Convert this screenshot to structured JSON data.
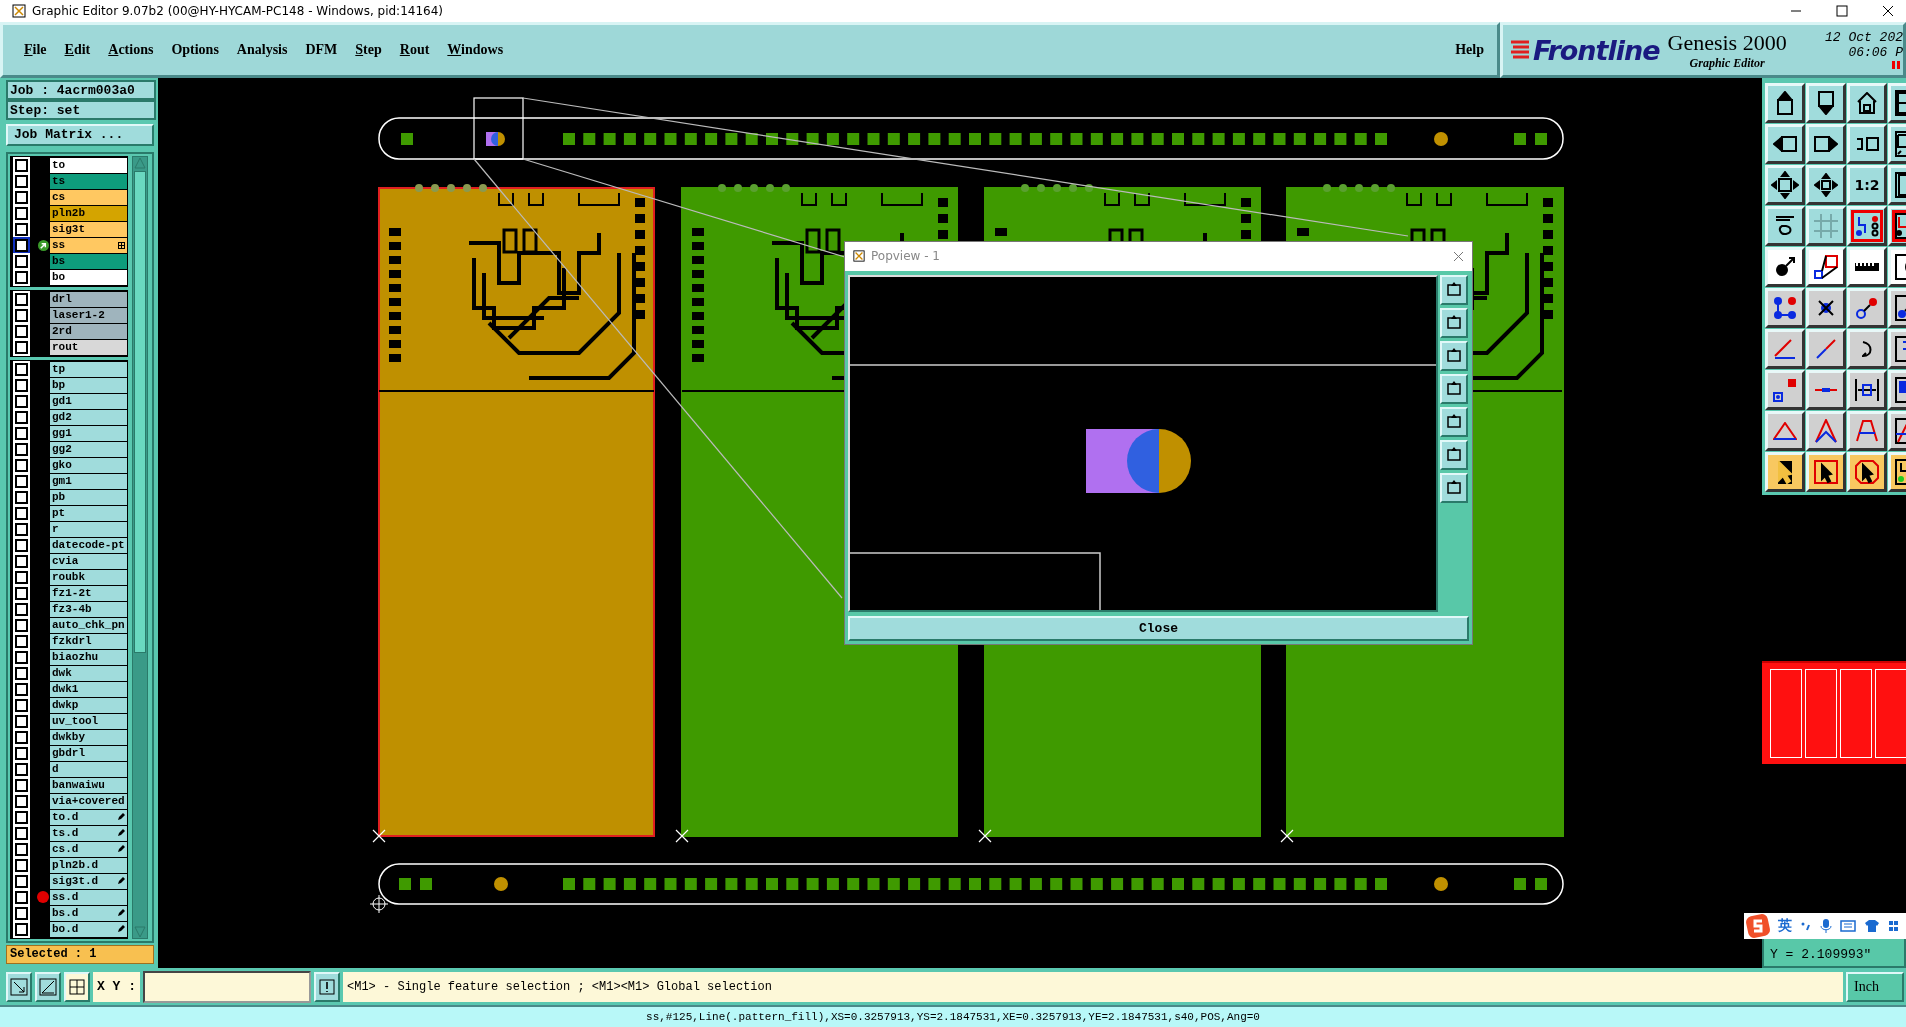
{
  "window": {
    "title": "Graphic Editor 9.07b2 (00@HY-HYCAM-PC148 - Windows, pid:14164)"
  },
  "menu": [
    {
      "label": "File",
      "underlined": true
    },
    {
      "label": "Edit",
      "underlined": true
    },
    {
      "label": "Actions",
      "underlined": true
    },
    {
      "label": "Options",
      "underlined": false
    },
    {
      "label": "Analysis",
      "underlined": false
    },
    {
      "label": "DFM",
      "underlined": false
    },
    {
      "label": "Step",
      "underlined": true
    },
    {
      "label": "Rout",
      "underlined": true
    },
    {
      "label": "Windows",
      "underlined": true
    }
  ],
  "help": "Help",
  "brand": {
    "logo": "Frontline",
    "product": "Genesis 2000",
    "subtitle": "Graphic Editor",
    "date": "12 Oct 202",
    "time": "06:06 P"
  },
  "job": {
    "job": "Job  :  4acrm003a0",
    "step": "Step:  set",
    "matrix_button": "Job Matrix ..."
  },
  "layer_groups": [
    {
      "layers": [
        {
          "name": "to",
          "color": "#ffffff",
          "checked": false,
          "work": false,
          "dot": false,
          "kind": "plain"
        },
        {
          "name": "ts",
          "color": "#0e9c7c",
          "checked": false,
          "work": false,
          "dot": false,
          "kind": "plain"
        },
        {
          "name": "cs",
          "color": "#ffc861",
          "checked": false,
          "work": false,
          "dot": false,
          "kind": "plain"
        },
        {
          "name": "pln2b",
          "color": "#d4a400",
          "checked": false,
          "work": false,
          "dot": false,
          "kind": "plain"
        },
        {
          "name": "sig3t",
          "color": "#ffc861",
          "checked": false,
          "work": false,
          "dot": false,
          "kind": "plain"
        },
        {
          "name": "ss",
          "color": "#ffc861",
          "checked": false,
          "work": true,
          "dot": false,
          "kind": "grid"
        },
        {
          "name": "bs",
          "color": "#0e9c7c",
          "checked": false,
          "work": false,
          "dot": false,
          "kind": "plain"
        },
        {
          "name": "bo",
          "color": "#ffffff",
          "checked": false,
          "work": false,
          "dot": false,
          "kind": "plain"
        }
      ]
    },
    {
      "layers": [
        {
          "name": "drl",
          "color": "#9fb4bd",
          "checked": false,
          "work": false,
          "dot": false,
          "kind": "plain"
        },
        {
          "name": "laser1-2",
          "color": "#9fb4bd",
          "checked": false,
          "work": false,
          "dot": false,
          "kind": "plain"
        },
        {
          "name": "2rd",
          "color": "#9fb4bd",
          "checked": false,
          "work": false,
          "dot": false,
          "kind": "plain"
        },
        {
          "name": "rout",
          "color": "#d8d8d8",
          "checked": false,
          "work": false,
          "dot": false,
          "kind": "plain"
        }
      ]
    },
    {
      "layers": [
        {
          "name": "tp",
          "color": "#a0dcdc",
          "checked": false,
          "work": false,
          "dot": false,
          "kind": "plain"
        },
        {
          "name": "bp",
          "color": "#a0dcdc",
          "checked": false,
          "work": false,
          "dot": false,
          "kind": "plain"
        },
        {
          "name": "gd1",
          "color": "#a0dcdc",
          "checked": false,
          "work": false,
          "dot": false,
          "kind": "plain"
        },
        {
          "name": "gd2",
          "color": "#a0dcdc",
          "checked": false,
          "work": false,
          "dot": false,
          "kind": "plain"
        },
        {
          "name": "gg1",
          "color": "#a0dcdc",
          "checked": false,
          "work": false,
          "dot": false,
          "kind": "plain"
        },
        {
          "name": "gg2",
          "color": "#a0dcdc",
          "checked": false,
          "work": false,
          "dot": false,
          "kind": "plain"
        },
        {
          "name": "gko",
          "color": "#a0dcdc",
          "checked": false,
          "work": false,
          "dot": false,
          "kind": "plain"
        },
        {
          "name": "gm1",
          "color": "#a0dcdc",
          "checked": false,
          "work": false,
          "dot": false,
          "kind": "plain"
        },
        {
          "name": "pb",
          "color": "#a0dcdc",
          "checked": false,
          "work": false,
          "dot": false,
          "kind": "plain"
        },
        {
          "name": "pt",
          "color": "#a0dcdc",
          "checked": false,
          "work": false,
          "dot": false,
          "kind": "plain"
        },
        {
          "name": "r",
          "color": "#a0dcdc",
          "checked": false,
          "work": false,
          "dot": false,
          "kind": "plain"
        },
        {
          "name": "datecode-pt",
          "color": "#a0dcdc",
          "checked": false,
          "work": false,
          "dot": false,
          "kind": "plain"
        },
        {
          "name": "cvia",
          "color": "#a0dcdc",
          "checked": false,
          "work": false,
          "dot": false,
          "kind": "plain"
        },
        {
          "name": "roubk",
          "color": "#a0dcdc",
          "checked": false,
          "work": false,
          "dot": false,
          "kind": "plain"
        },
        {
          "name": "fz1-2t",
          "color": "#a0dcdc",
          "checked": false,
          "work": false,
          "dot": false,
          "kind": "plain"
        },
        {
          "name": "fz3-4b",
          "color": "#a0dcdc",
          "checked": false,
          "work": false,
          "dot": false,
          "kind": "plain"
        },
        {
          "name": "auto_chk_pn",
          "color": "#a0dcdc",
          "checked": false,
          "work": false,
          "dot": false,
          "kind": "plain"
        },
        {
          "name": "fzkdrl",
          "color": "#a0dcdc",
          "checked": false,
          "work": false,
          "dot": false,
          "kind": "plain"
        },
        {
          "name": "biaozhu",
          "color": "#a0dcdc",
          "checked": false,
          "work": false,
          "dot": false,
          "kind": "plain"
        },
        {
          "name": "dwk",
          "color": "#a0dcdc",
          "checked": false,
          "work": false,
          "dot": false,
          "kind": "plain"
        },
        {
          "name": "dwk1",
          "color": "#a0dcdc",
          "checked": false,
          "work": false,
          "dot": false,
          "kind": "plain"
        },
        {
          "name": "dwkp",
          "color": "#a0dcdc",
          "checked": false,
          "work": false,
          "dot": false,
          "kind": "plain"
        },
        {
          "name": "uv_tool",
          "color": "#a0dcdc",
          "checked": false,
          "work": false,
          "dot": false,
          "kind": "plain"
        },
        {
          "name": "dwkby",
          "color": "#a0dcdc",
          "checked": false,
          "work": false,
          "dot": false,
          "kind": "plain"
        },
        {
          "name": "gbdrl",
          "color": "#a0dcdc",
          "checked": false,
          "work": false,
          "dot": false,
          "kind": "plain"
        },
        {
          "name": "d",
          "color": "#a0dcdc",
          "checked": false,
          "work": false,
          "dot": false,
          "kind": "plain"
        },
        {
          "name": "banwaiwu",
          "color": "#a0dcdc",
          "checked": false,
          "work": false,
          "dot": false,
          "kind": "plain"
        },
        {
          "name": "via+covered",
          "color": "#a0dcdc",
          "checked": false,
          "work": false,
          "dot": false,
          "kind": "plain"
        },
        {
          "name": "to.d",
          "color": "#a0dcdc",
          "checked": false,
          "work": false,
          "dot": false,
          "kind": "pen"
        },
        {
          "name": "ts.d",
          "color": "#a0dcdc",
          "checked": false,
          "work": false,
          "dot": false,
          "kind": "pen"
        },
        {
          "name": "cs.d",
          "color": "#a0dcdc",
          "checked": false,
          "work": false,
          "dot": false,
          "kind": "pen"
        },
        {
          "name": "pln2b.d",
          "color": "#a0dcdc",
          "checked": false,
          "work": false,
          "dot": false,
          "kind": "plain"
        },
        {
          "name": "sig3t.d",
          "color": "#a0dcdc",
          "checked": false,
          "work": false,
          "dot": false,
          "kind": "pen"
        },
        {
          "name": "ss.d",
          "color": "#a0dcdc",
          "checked": false,
          "work": false,
          "dot": true,
          "kind": "plain"
        },
        {
          "name": "bs.d",
          "color": "#a0dcdc",
          "checked": false,
          "work": false,
          "dot": false,
          "kind": "pen"
        },
        {
          "name": "bo.d",
          "color": "#a0dcdc",
          "checked": false,
          "work": false,
          "dot": false,
          "kind": "pen"
        }
      ]
    }
  ],
  "selected_count": "Selected : 1",
  "zoom_ratio": "1:2",
  "popview": {
    "title": "Popview - 1",
    "close": "Close"
  },
  "coordinates": {
    "y": "Y = 2.109993\""
  },
  "ime": {
    "label": "英"
  },
  "bottom": {
    "xy_label": "X Y :",
    "message": "<M1> - Single feature selection ; <M1><M1> Global selection",
    "units": "Inch"
  },
  "status_bar": "ss,#125,Line(.pattern_fill),XS=0.3257913,YS=2.1847531,XE=0.3257913,YE=2.1847531,s40,POS,Ang=0"
}
